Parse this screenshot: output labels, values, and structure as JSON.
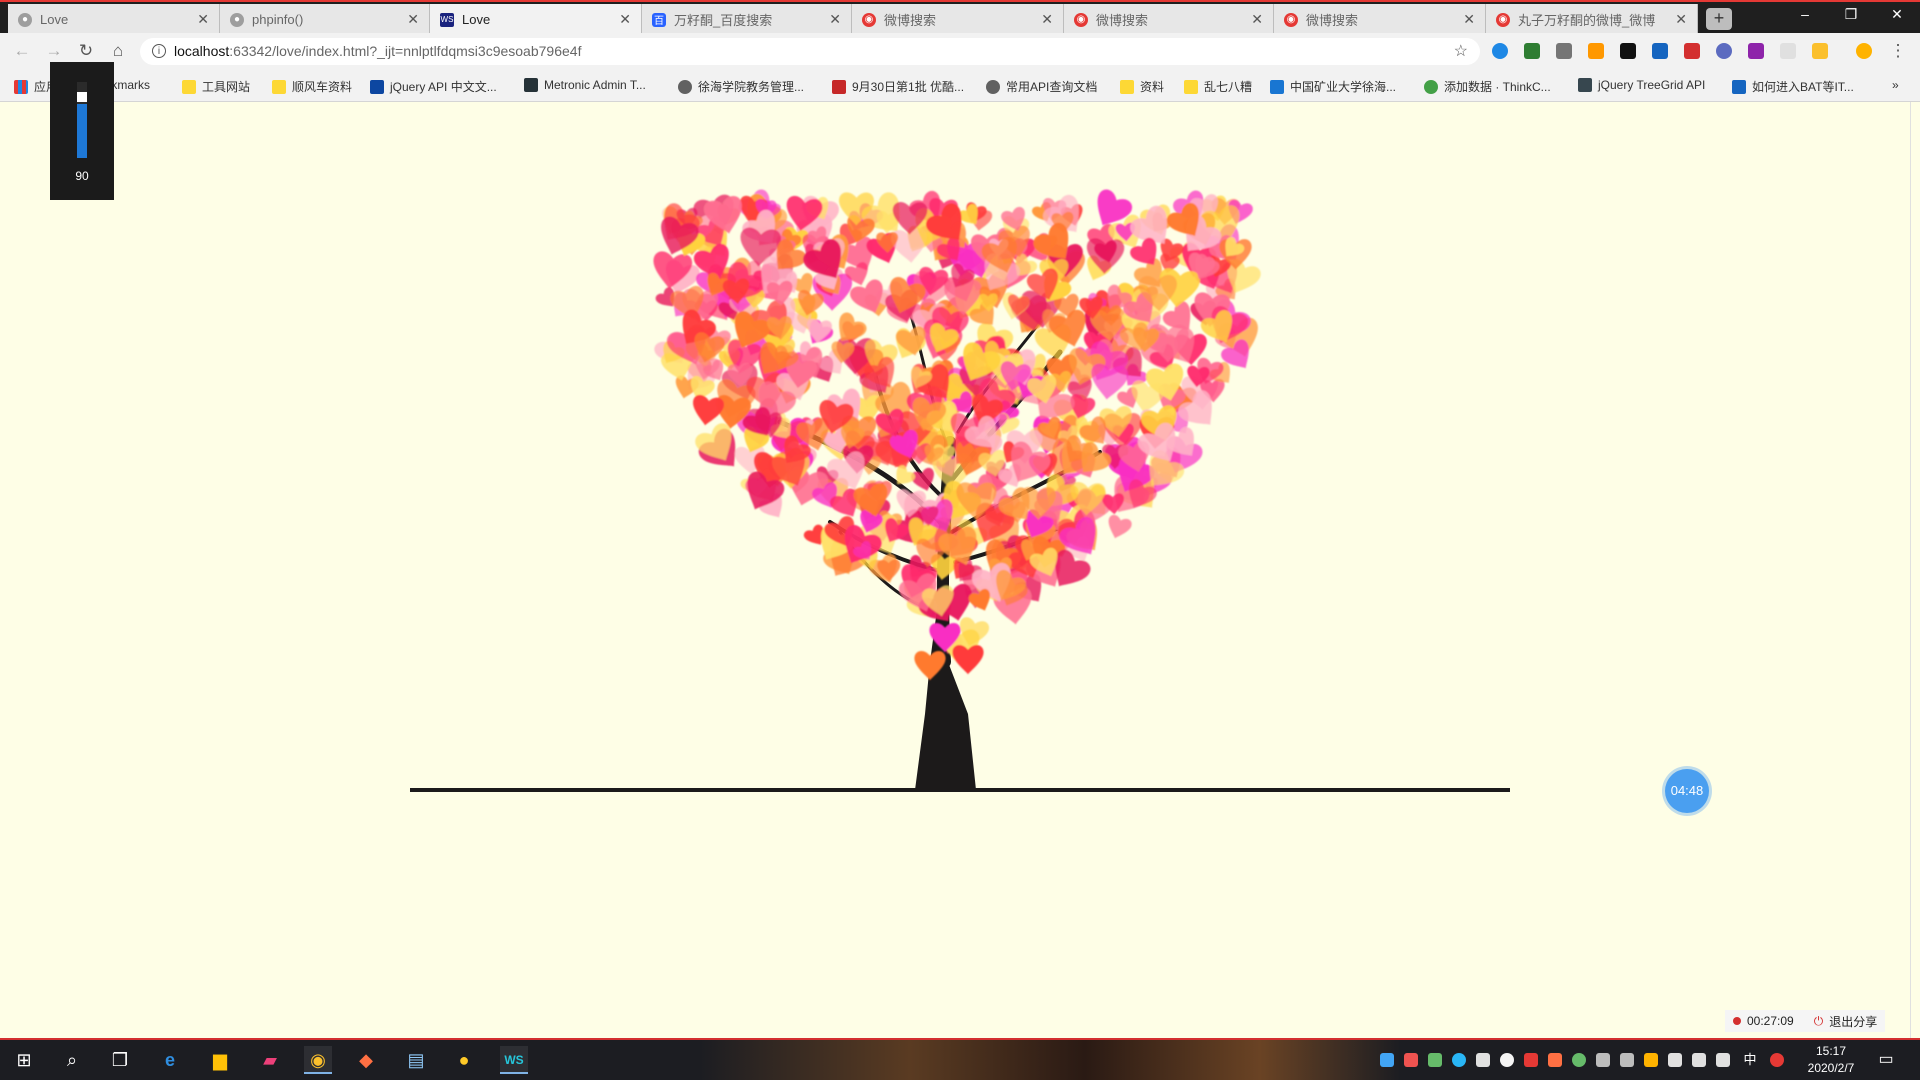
{
  "tabs": [
    {
      "title": "Love",
      "active": false,
      "favicon": "globe-icon"
    },
    {
      "title": "phpinfo()",
      "active": false,
      "favicon": "globe-icon"
    },
    {
      "title": "Love",
      "active": true,
      "favicon": "webstorm-icon"
    },
    {
      "title": "万籽酮_百度搜索",
      "active": false,
      "favicon": "baidu-icon"
    },
    {
      "title": "微博搜索",
      "active": false,
      "favicon": "weibo-icon"
    },
    {
      "title": "微博搜索",
      "active": false,
      "favicon": "weibo-icon"
    },
    {
      "title": "微博搜索",
      "active": false,
      "favicon": "weibo-icon"
    },
    {
      "title": "丸子万籽酮的微博_微博",
      "active": false,
      "favicon": "weibo-icon"
    }
  ],
  "address_bar": {
    "host": "localhost",
    "rest": ":63342/love/index.html?_ijt=nnlptlfdqmsi3c9esoab796e4f"
  },
  "bookmarks": [
    {
      "label": "应用",
      "icon": "apps-icon"
    },
    {
      "label": "Bookmarks",
      "icon": "folder-icon"
    },
    {
      "label": "工具网站",
      "icon": "folder-icon"
    },
    {
      "label": "顺风车资料",
      "icon": "folder-icon"
    },
    {
      "label": "jQuery API 中文文...",
      "icon": "jquery-icon"
    },
    {
      "label": "Metronic Admin T...",
      "icon": "metronic-icon"
    },
    {
      "label": "徐海学院教务管理...",
      "icon": "globe-icon"
    },
    {
      "label": "9月30日第1批 优酷...",
      "icon": "vip-icon"
    },
    {
      "label": "常用API查询文档",
      "icon": "globe-icon"
    },
    {
      "label": "资料",
      "icon": "folder-icon"
    },
    {
      "label": "乱七八糟",
      "icon": "folder-icon"
    },
    {
      "label": "中国矿业大学徐海...",
      "icon": "cumt-icon"
    },
    {
      "label": "添加数据 · ThinkC...",
      "icon": "thinkcmf-icon"
    },
    {
      "label": "jQuery TreeGrid API",
      "icon": "treegrid-icon"
    },
    {
      "label": "如何进入BAT等IT...",
      "icon": "zhihu-icon"
    }
  ],
  "volume": {
    "value": "90",
    "level": 0.9
  },
  "timer": {
    "label": "04:48"
  },
  "recording": {
    "elapsed": "00:27:09",
    "exit_label": "退出分享"
  },
  "clock": {
    "time": "15:17",
    "date": "2020/2/7"
  },
  "colors": {
    "page_bg": "#fefee6",
    "heart_palette": [
      "#ff2a6d",
      "#ff6f91",
      "#ff9a3c",
      "#ffd23f",
      "#f92fc3",
      "#ff3b3b",
      "#ffb3c6",
      "#ff7a2f",
      "#ffe066",
      "#e8175d"
    ],
    "trunk": "#1c1a1a"
  }
}
